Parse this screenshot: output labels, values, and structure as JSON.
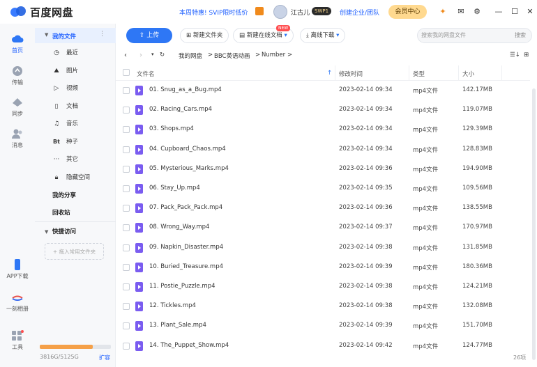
{
  "app": {
    "title": "百度网盘"
  },
  "topbar": {
    "promo": "本周特惠! SVIP限时低价",
    "username": "江古儿",
    "svip_badge": "SWP1",
    "enterprise": "创建企业/团队",
    "vip_center": "会员中心"
  },
  "rail": {
    "items": [
      {
        "label": "首页",
        "icon": "cloud-home-icon"
      },
      {
        "label": "传输",
        "icon": "transfer-icon"
      },
      {
        "label": "同步",
        "icon": "sync-icon"
      },
      {
        "label": "消息",
        "icon": "message-icon"
      },
      {
        "label": "APP下载",
        "icon": "phone-icon"
      },
      {
        "label": "一刻相册",
        "icon": "album-icon"
      },
      {
        "label": "工具",
        "icon": "tools-icon"
      }
    ]
  },
  "sidebar": {
    "my_files": "我的文件",
    "items": [
      {
        "label": "最近",
        "icon": "clock-icon"
      },
      {
        "label": "图片",
        "icon": "image-icon"
      },
      {
        "label": "视频",
        "icon": "video-icon"
      },
      {
        "label": "文档",
        "icon": "document-icon"
      },
      {
        "label": "音乐",
        "icon": "music-icon"
      },
      {
        "label": "种子",
        "icon": "bt-icon"
      },
      {
        "label": "其它",
        "icon": "more-icon"
      },
      {
        "label": "隐藏空间",
        "icon": "lock-icon"
      }
    ],
    "my_share": "我的分享",
    "recycle": "回收站",
    "quick_access": "快捷访问",
    "add_fav": "+ 拖入常用文件夹",
    "quota_text": "3816G/5125G",
    "quota_fraction": 0.745,
    "expand": "扩容"
  },
  "toolbar": {
    "upload": "上传",
    "new_folder": "新建文件夹",
    "new_doc": "新建在线文档",
    "new_tag": "NEW",
    "offline": "离线下载",
    "search_placeholder": "搜索我的网盘文件",
    "search_btn": "搜索"
  },
  "breadcrumb": {
    "root": "我的网盘",
    "folder1": "BBC英语动画",
    "folder2": "Number"
  },
  "table": {
    "headers": {
      "name": "文件名",
      "modified": "修改时间",
      "type": "类型",
      "size": "大小"
    },
    "rows": [
      {
        "name": "01. Snug_as_a_Bug.mp4",
        "date": "2023-02-14 09:34",
        "type": "mp4文件",
        "size": "142.17MB"
      },
      {
        "name": "02. Racing_Cars.mp4",
        "date": "2023-02-14 09:34",
        "type": "mp4文件",
        "size": "119.07MB"
      },
      {
        "name": "03. Shops.mp4",
        "date": "2023-02-14 09:34",
        "type": "mp4文件",
        "size": "129.39MB"
      },
      {
        "name": "04. Cupboard_Chaos.mp4",
        "date": "2023-02-14 09:34",
        "type": "mp4文件",
        "size": "128.83MB"
      },
      {
        "name": "05. Mysterious_Marks.mp4",
        "date": "2023-02-14 09:36",
        "type": "mp4文件",
        "size": "194.90MB"
      },
      {
        "name": "06. Stay_Up.mp4",
        "date": "2023-02-14 09:35",
        "type": "mp4文件",
        "size": "109.56MB"
      },
      {
        "name": "07. Pack_Pack_Pack.mp4",
        "date": "2023-02-14 09:36",
        "type": "mp4文件",
        "size": "138.55MB"
      },
      {
        "name": "08. Wrong_Way.mp4",
        "date": "2023-02-14 09:37",
        "type": "mp4文件",
        "size": "170.97MB"
      },
      {
        "name": "09. Napkin_Disaster.mp4",
        "date": "2023-02-14 09:38",
        "type": "mp4文件",
        "size": "131.85MB"
      },
      {
        "name": "10. Buried_Treasure.mp4",
        "date": "2023-02-14 09:39",
        "type": "mp4文件",
        "size": "180.36MB"
      },
      {
        "name": "11. Postie_Puzzle.mp4",
        "date": "2023-02-14 09:38",
        "type": "mp4文件",
        "size": "124.21MB"
      },
      {
        "name": "12. Tickles.mp4",
        "date": "2023-02-14 09:38",
        "type": "mp4文件",
        "size": "132.08MB"
      },
      {
        "name": "13. Plant_Sale.mp4",
        "date": "2023-02-14 09:39",
        "type": "mp4文件",
        "size": "151.70MB"
      },
      {
        "name": "14. The_Puppet_Show.mp4",
        "date": "2023-02-14 09:42",
        "type": "mp4文件",
        "size": "124.77MB"
      }
    ],
    "count": "26项"
  }
}
